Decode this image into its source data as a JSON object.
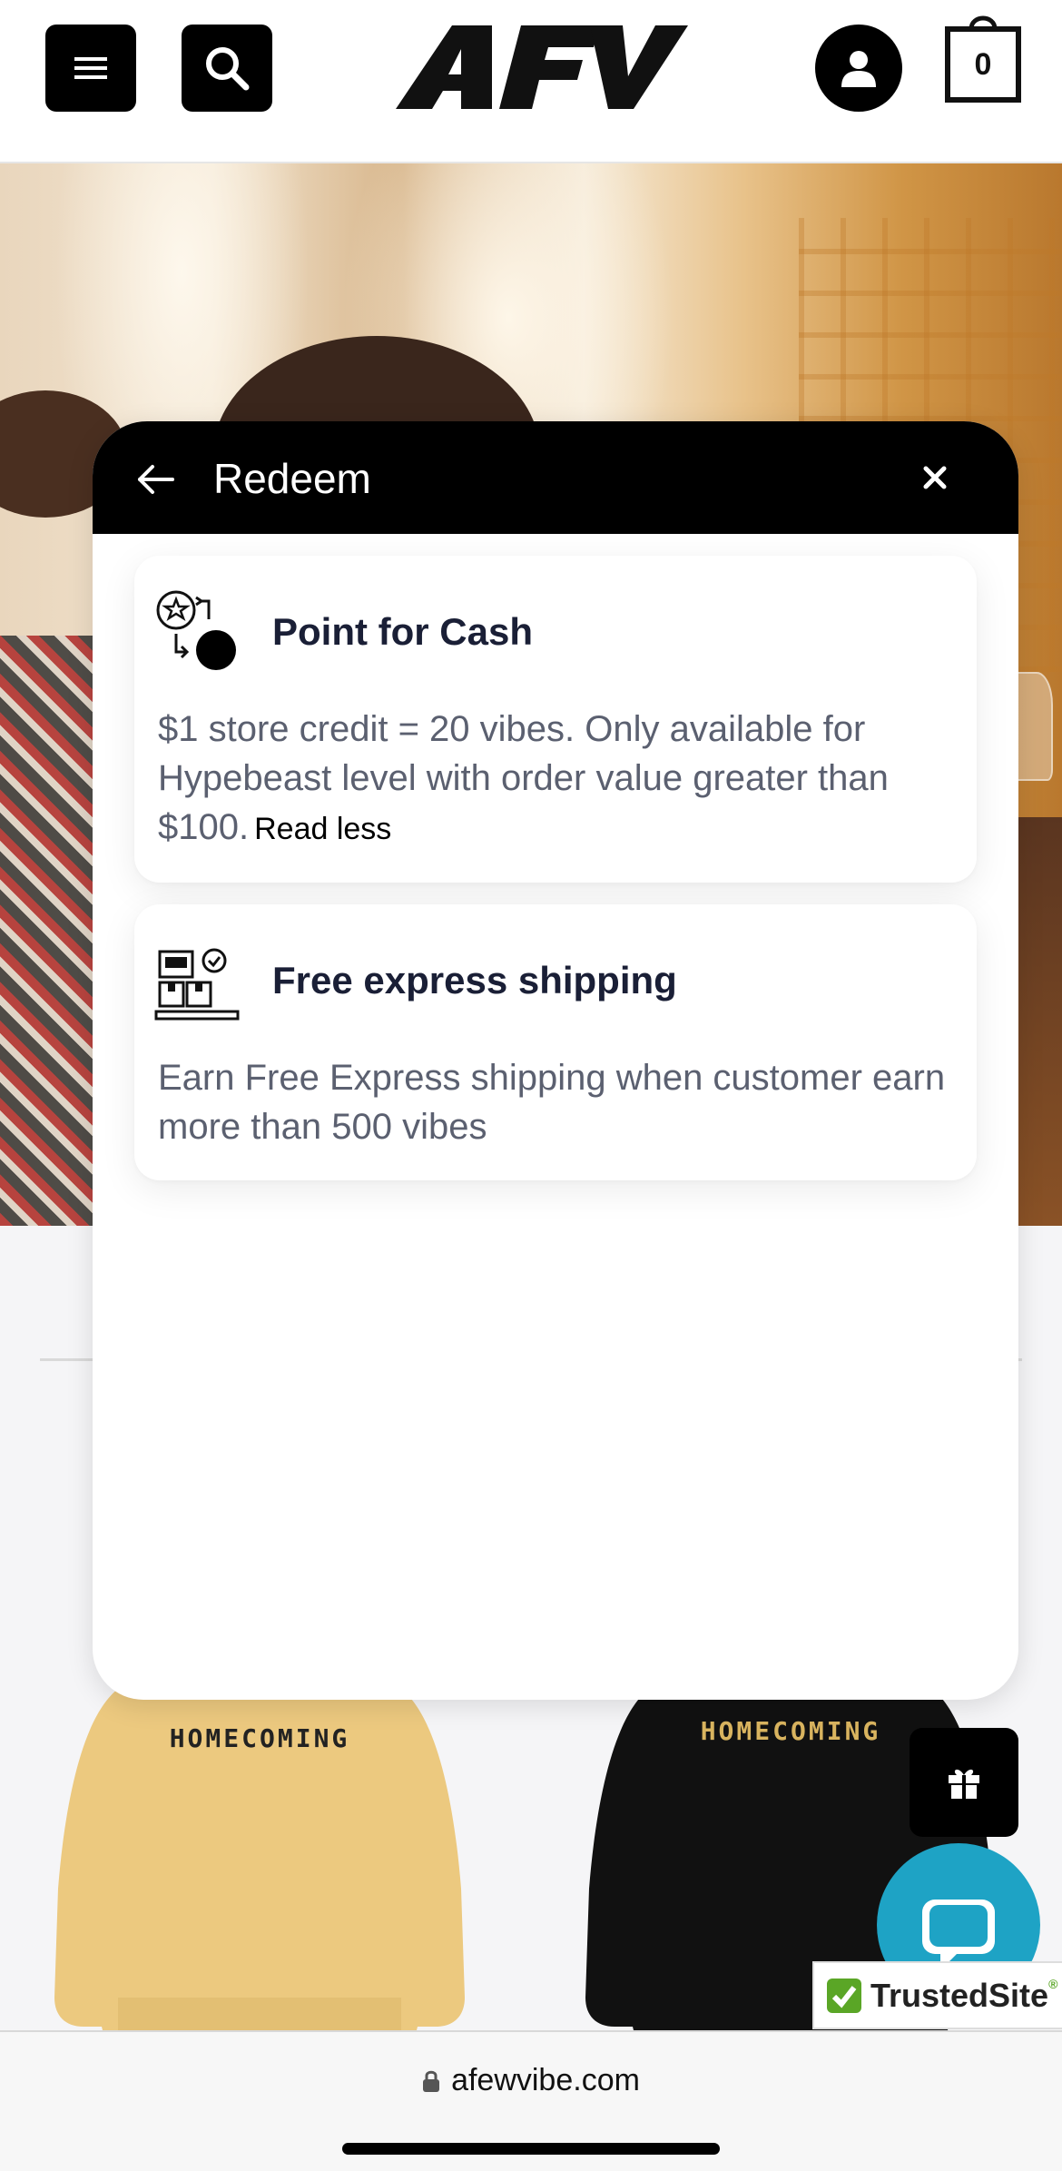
{
  "header": {
    "logo_text": "AFV",
    "cart_count": "0"
  },
  "products": [
    {
      "label": "HOMECOMING",
      "color": "#ecc97f"
    },
    {
      "label": "HOMECOMING",
      "color": "#111111"
    }
  ],
  "modal": {
    "title": "Redeem",
    "cards": [
      {
        "title": "Point for Cash",
        "description": "$1 store credit = 20 vibes. Only available for Hypebeast level with order value greater than $100.",
        "toggle_label": "Read less",
        "icon": "points-exchange-icon"
      },
      {
        "title": "Free express shipping",
        "description": "Earn Free Express shipping when customer earn more than 500 vibes",
        "icon": "shipping-boxes-icon"
      }
    ]
  },
  "floating": {
    "gift_icon": "gift-icon",
    "chat_icon": "chat-icon",
    "trusted_badge": "TrustedSite",
    "trusted_tm": "®"
  },
  "browser": {
    "url": "afewvibe.com"
  },
  "colors": {
    "accent_black": "#000000",
    "chat_blue": "#1ea3c5",
    "trusted_green": "#5aa626",
    "description_gray": "#5b6070",
    "title_navy": "#1a1f36"
  }
}
